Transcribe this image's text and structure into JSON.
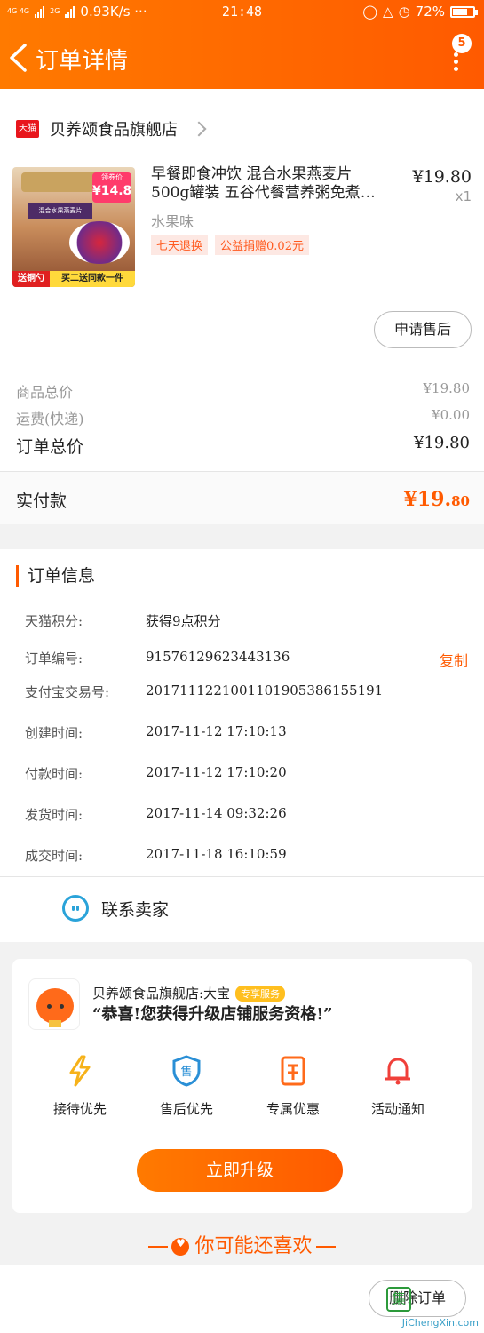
{
  "status_bar": {
    "network_small": "4G 4G",
    "network_2g": "2G",
    "speed": "0.93K/s ···",
    "time": "21:48",
    "battery_percent": "72%",
    "battery_level": 0.72
  },
  "header": {
    "title": "订单详情",
    "badge_count": "5"
  },
  "store": {
    "logo_text": "天猫",
    "name": "贝养颂食品旗舰店"
  },
  "product": {
    "image_coupon_top": "领券价",
    "image_coupon_price": "¥14.8",
    "image_banner_left": "送铜勺",
    "image_banner_right": "买二送同款一件",
    "image_jar_label": "混合水果燕麦片",
    "title_line1": "早餐即食冲饮 混合水果燕麦片",
    "title_line2": "500g罐装 五谷代餐营养粥免煮…",
    "price": "¥19.80",
    "qty": "x1",
    "variant": "水果味",
    "tags": [
      "七天退换",
      "公益捐赠0.02元"
    ],
    "after_sale_button": "申请售后"
  },
  "summary": {
    "goods_total_label": "商品总价",
    "goods_total_value": "¥19.80",
    "shipping_label": "运费(快递)",
    "shipping_value": "¥0.00",
    "order_total_label": "订单总价",
    "order_total_value": "¥19.80",
    "paid_label": "实付款",
    "paid_value_main": "¥19.",
    "paid_value_cents": "80"
  },
  "order_info": {
    "section_title": "订单信息",
    "rows": [
      {
        "key": "天猫积分:",
        "value": "获得9点积分"
      },
      {
        "key": "订单编号:",
        "value": "91576129623443136",
        "action": "复制"
      },
      {
        "key": "支付宝交易号:",
        "value": "2017111221001101905386155191"
      },
      {
        "key": "创建时间:",
        "value": "2017-11-12 17:10:13"
      },
      {
        "key": "付款时间:",
        "value": "2017-11-12 17:10:20"
      },
      {
        "key": "发货时间:",
        "value": "2017-11-14 09:32:26"
      },
      {
        "key": "成交时间:",
        "value": "2017-11-18 16:10:59"
      }
    ],
    "contact_button": "联系卖家"
  },
  "membership": {
    "store_line": "贝养颂食品旗舰店:大宝",
    "vip_tag": "专享服务",
    "message": "“恭喜!您获得升级店铺服务资格!”",
    "perks": [
      {
        "icon": "lightning-icon",
        "label": "接待优先",
        "color": "#f6b21a"
      },
      {
        "icon": "after-sale-icon",
        "label": "售后优先",
        "color": "#2a8fd6"
      },
      {
        "icon": "ticket-icon",
        "label": "专属优惠",
        "color": "#ff6a1a"
      },
      {
        "icon": "bell-icon",
        "label": "活动通知",
        "color": "#f0403a"
      }
    ],
    "upgrade_button": "立即升级",
    "perk_after_sale_glyph": "售"
  },
  "recommend": {
    "title": "你可能还喜欢"
  },
  "bottom": {
    "delete_button": "删除订单"
  },
  "watermark": {
    "logo_char": "集",
    "text": "JiChengXin.com"
  },
  "colors": {
    "brand_orange": "#ff5a00",
    "tmall_red": "#e8161c"
  }
}
